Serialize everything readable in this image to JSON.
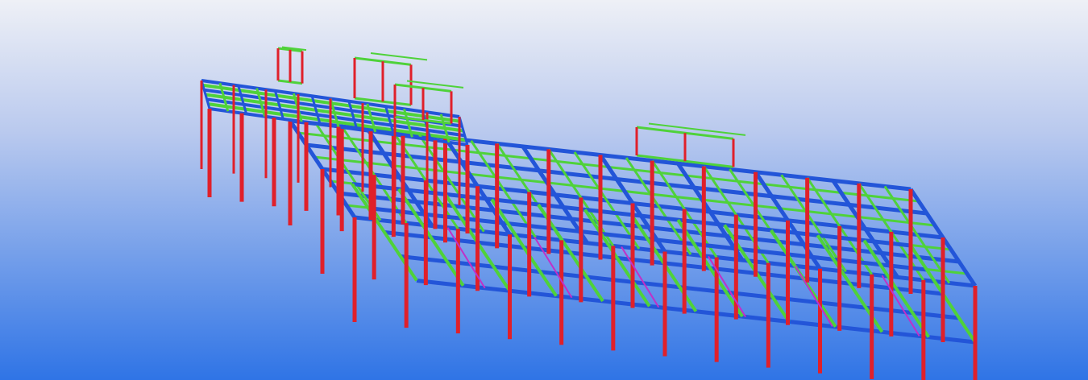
{
  "viewport": {
    "background_top": "#eef0f6",
    "background_bottom": "#2f74e6"
  },
  "model": {
    "description_icon": "steel-frame-3d-model",
    "colors": {
      "columns": "#e0202a",
      "beams": "#2355d8",
      "secondary_beams": "#4fd23a",
      "bracing": "#c030c8",
      "accent": "#f0d020"
    }
  }
}
